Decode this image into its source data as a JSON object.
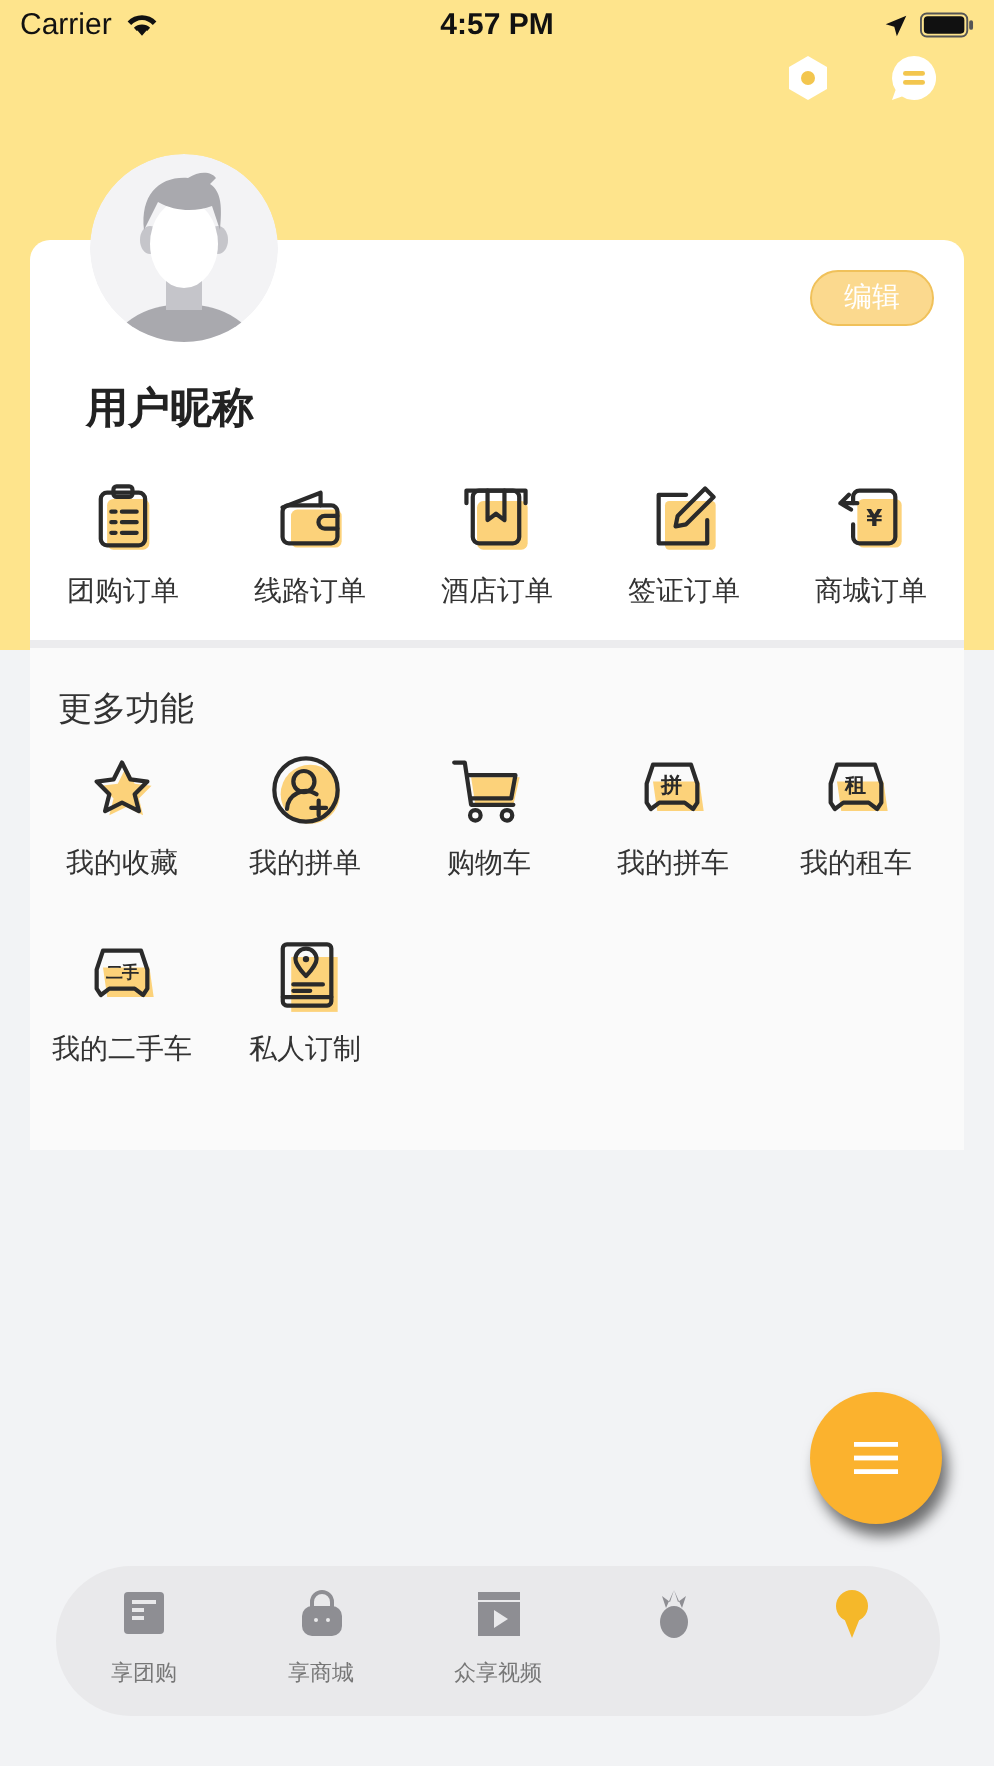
{
  "status_bar": {
    "carrier": "Carrier",
    "time": "4:57 PM"
  },
  "profile": {
    "nickname": "用户昵称",
    "edit_button": "编辑"
  },
  "orders": [
    {
      "label": "团购订单"
    },
    {
      "label": "线路订单"
    },
    {
      "label": "酒店订单"
    },
    {
      "label": "签证订单"
    },
    {
      "label": "商城订单",
      "symbol": "¥"
    }
  ],
  "more": {
    "title": "更多功能",
    "items": [
      {
        "label": "我的收藏"
      },
      {
        "label": "我的拼单"
      },
      {
        "label": "购物车"
      },
      {
        "label": "我的拼车",
        "badge": "拼"
      },
      {
        "label": "我的租车",
        "badge": "租"
      },
      {
        "label": "我的二手车",
        "badge": "二手"
      },
      {
        "label": "私人订制"
      }
    ]
  },
  "tab_bar": [
    {
      "label": "享团购",
      "selected": false
    },
    {
      "label": "享商城",
      "selected": false
    },
    {
      "label": "众享视频",
      "selected": false
    },
    {
      "selected": false
    },
    {
      "selected": true
    }
  ]
}
